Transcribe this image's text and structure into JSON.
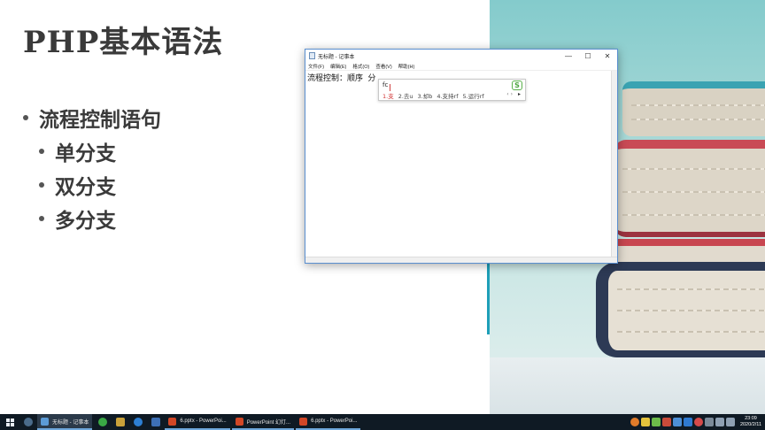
{
  "slide": {
    "title": "PHP基本语法",
    "bullets": [
      {
        "text": "流程控制语句",
        "level": 1
      },
      {
        "text": "单分支",
        "level": 2
      },
      {
        "text": "双分支",
        "level": 2
      },
      {
        "text": "多分支",
        "level": 2
      }
    ]
  },
  "notepad": {
    "title": "无标题 - 记事本",
    "controls": {
      "minimize": "—",
      "maximize": "☐",
      "close": "✕"
    },
    "menu": [
      "文件(F)",
      "编辑(E)",
      "格式(O)",
      "查看(V)",
      "帮助(H)"
    ],
    "content": "流程控制：顺序 分"
  },
  "ime": {
    "composition": "fc",
    "candidates": [
      "1.支",
      "2.去u",
      "3.却b",
      "4.支持rf",
      "5.运行rf"
    ],
    "nav": "‹ ›",
    "next": "▸",
    "logo": "S"
  },
  "taskbar": {
    "apps": [
      {
        "label": "无标题 - 记事本",
        "color": "#5c9bd6",
        "active": true
      },
      {
        "label": "6.pptx - PowerPoi...",
        "color": "#d24726",
        "active": false
      },
      {
        "label": "PowerPoint 幻灯...",
        "color": "#d24726",
        "active": false
      },
      {
        "label": "6.pptx - PowerPoi...",
        "color": "#d24726",
        "active": false
      }
    ],
    "clock_time": "23:09",
    "clock_date": "2020/2/11"
  },
  "colors": {
    "accent_teal": "#1e9fb8",
    "taskbar_bg": "#0f1a24",
    "window_border": "#5a8fd0"
  }
}
